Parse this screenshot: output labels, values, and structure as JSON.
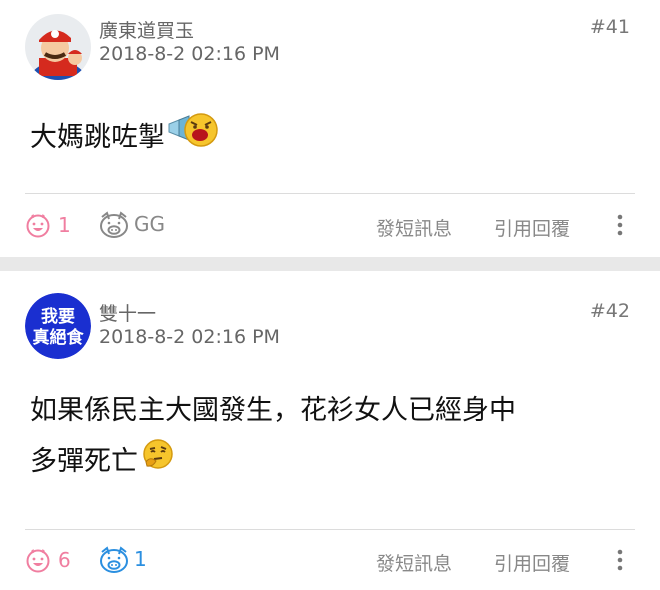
{
  "posts": [
    {
      "username": "廣東道買玉",
      "timestamp": "2018-8-2 02:16 PM",
      "post_number": "#41",
      "content_lines": [
        "大媽跳咗掣"
      ],
      "emoji": "shouting-face-emoji",
      "like_count": "1",
      "dislike_label": "GG",
      "dislike_color": "#888888",
      "message_label": "發短訊息",
      "quote_label": "引用回覆"
    },
    {
      "username": "雙十一",
      "timestamp": "2018-8-2 02:16 PM",
      "post_number": "#42",
      "avatar_text_top": "我要",
      "avatar_text_bottom": "真絕食",
      "content_lines": [
        "如果係民主大國發生，花衫女人已經身中",
        "多彈死亡"
      ],
      "emoji": "thinking-face-emoji",
      "like_count": "6",
      "dislike_label": "1",
      "dislike_color": "#2b8fe0",
      "message_label": "發短訊息",
      "quote_label": "引用回覆"
    }
  ],
  "colors": {
    "like_pink": "#f07ea0",
    "muted_text": "#888888",
    "separator": "#e8e8e8",
    "avatar_blue": "#1a2fd0"
  }
}
